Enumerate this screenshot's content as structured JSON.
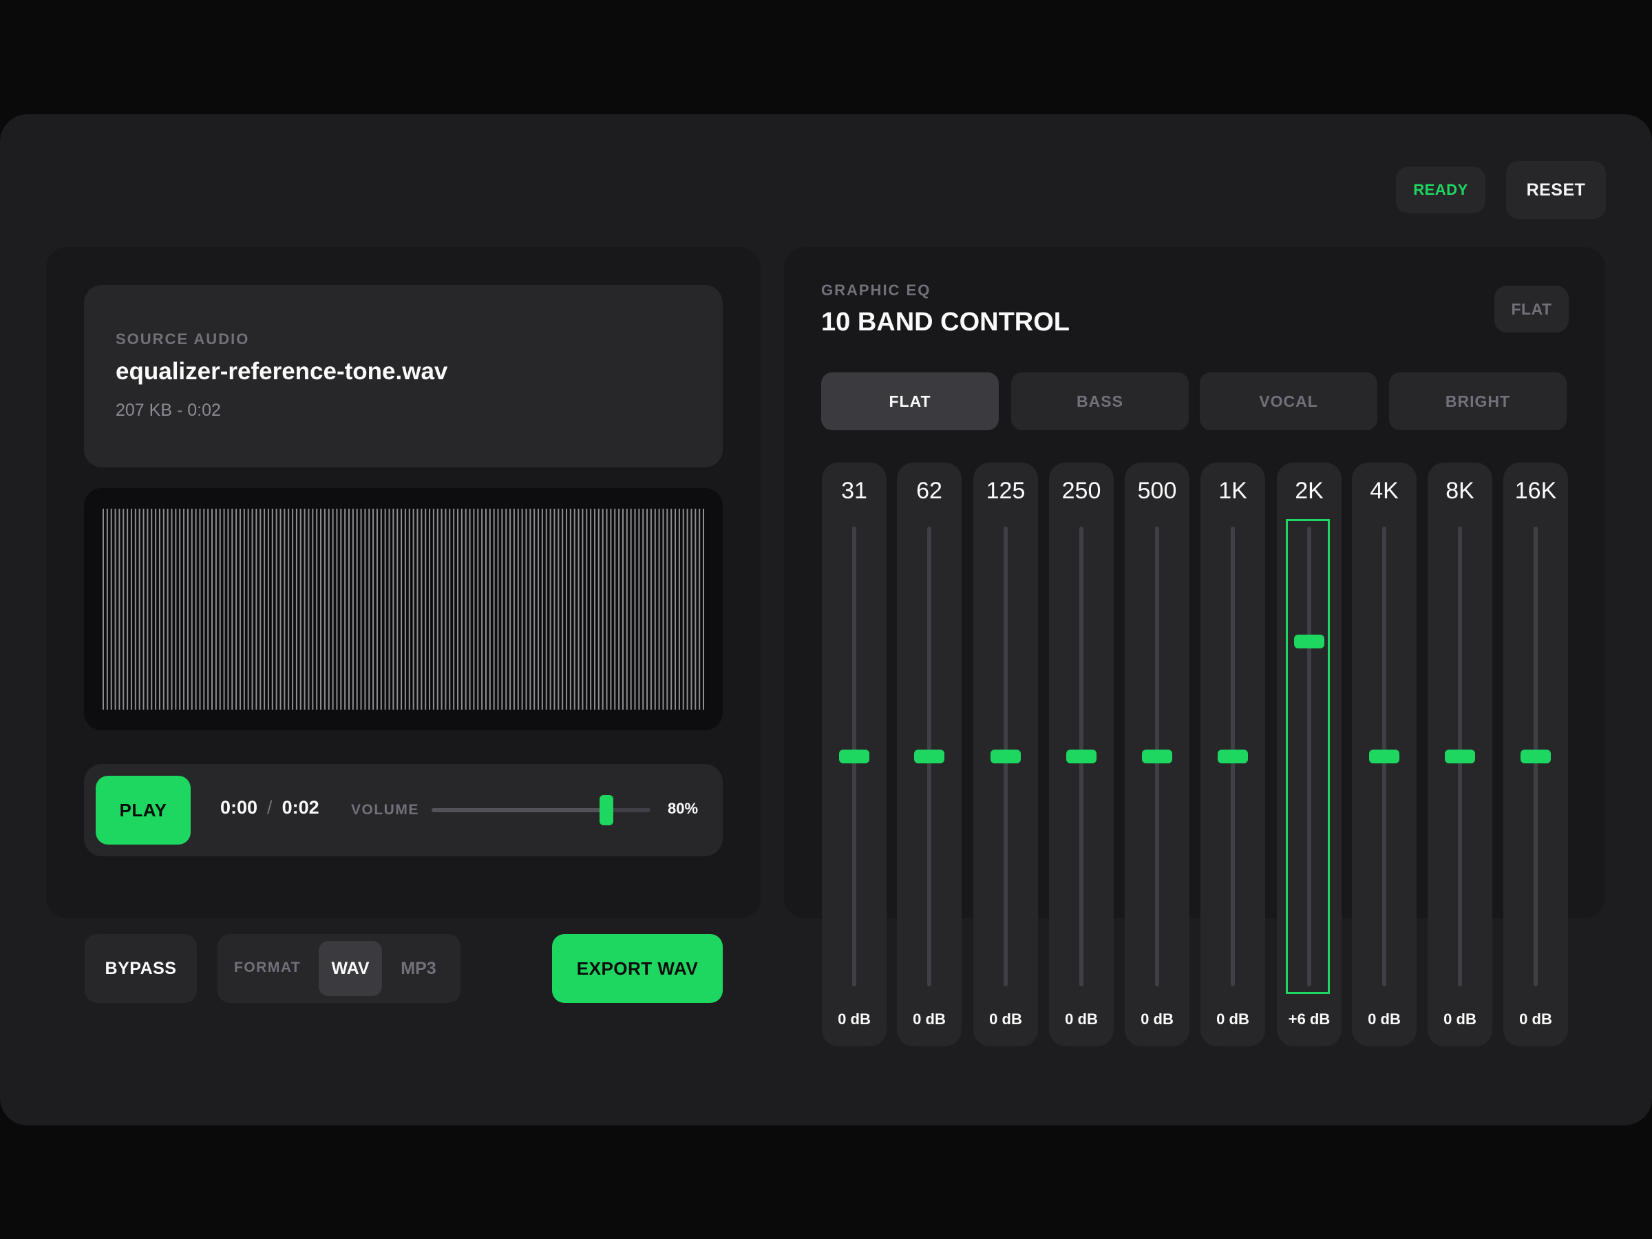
{
  "header": {
    "status": "READY",
    "reset_label": "RESET"
  },
  "source": {
    "eyebrow": "SOURCE AUDIO",
    "file_name": "equalizer-reference-tone.wav",
    "meta": "207 KB - 0:02"
  },
  "transport": {
    "play_label": "PLAY",
    "current_time": "0:00",
    "separator": "/",
    "duration": "0:02",
    "volume_label": "VOLUME",
    "volume_value": "80%",
    "volume_fraction": 0.8
  },
  "footer": {
    "bypass_label": "BYPASS",
    "format_label": "FORMAT",
    "formats": [
      "WAV",
      "MP3"
    ],
    "selected_format": "WAV",
    "export_label": "EXPORT WAV"
  },
  "eq": {
    "eyebrow": "GRAPHIC EQ",
    "title": "10 BAND CONTROL",
    "badge": "FLAT",
    "presets": [
      "FLAT",
      "BASS",
      "VOCAL",
      "BRIGHT"
    ],
    "active_preset": "FLAT",
    "gain_range_db": [
      -12,
      12
    ],
    "bands": [
      {
        "freq": "31",
        "gain_label": "0 dB",
        "gain_db": 0
      },
      {
        "freq": "62",
        "gain_label": "0 dB",
        "gain_db": 0
      },
      {
        "freq": "125",
        "gain_label": "0 dB",
        "gain_db": 0
      },
      {
        "freq": "250",
        "gain_label": "0 dB",
        "gain_db": 0
      },
      {
        "freq": "500",
        "gain_label": "0 dB",
        "gain_db": 0
      },
      {
        "freq": "1K",
        "gain_label": "0 dB",
        "gain_db": 0
      },
      {
        "freq": "2K",
        "gain_label": "+6 dB",
        "gain_db": 6,
        "focused": true
      },
      {
        "freq": "4K",
        "gain_label": "0 dB",
        "gain_db": 0
      },
      {
        "freq": "8K",
        "gain_label": "0 dB",
        "gain_db": 0
      },
      {
        "freq": "16K",
        "gain_label": "0 dB",
        "gain_db": 0
      }
    ]
  },
  "colors": {
    "accent": "#1ed760",
    "background": "#0a0a0a",
    "surface": "#1d1d20",
    "card": "#27272a"
  }
}
